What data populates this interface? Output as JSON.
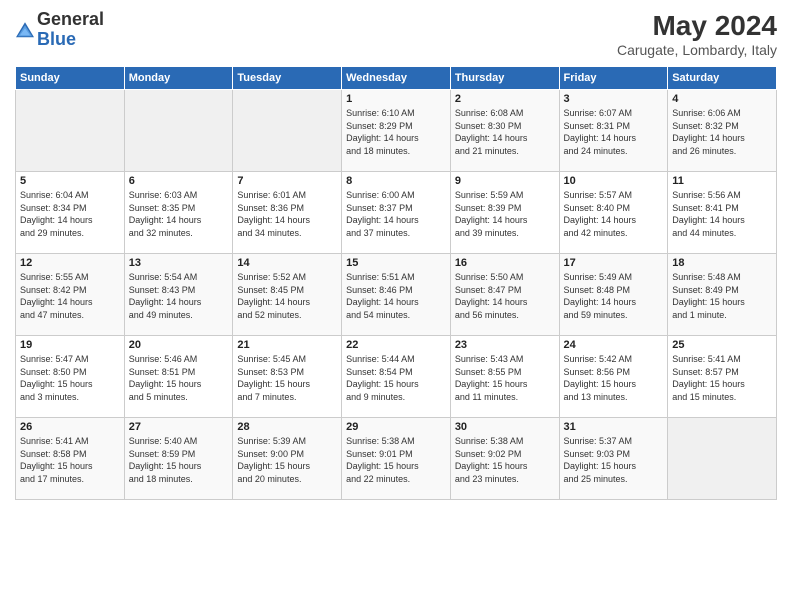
{
  "logo": {
    "line1": "General",
    "line2": "Blue"
  },
  "title": "May 2024",
  "location": "Carugate, Lombardy, Italy",
  "weekdays": [
    "Sunday",
    "Monday",
    "Tuesday",
    "Wednesday",
    "Thursday",
    "Friday",
    "Saturday"
  ],
  "weeks": [
    [
      {
        "day": "",
        "info": ""
      },
      {
        "day": "",
        "info": ""
      },
      {
        "day": "",
        "info": ""
      },
      {
        "day": "1",
        "info": "Sunrise: 6:10 AM\nSunset: 8:29 PM\nDaylight: 14 hours\nand 18 minutes."
      },
      {
        "day": "2",
        "info": "Sunrise: 6:08 AM\nSunset: 8:30 PM\nDaylight: 14 hours\nand 21 minutes."
      },
      {
        "day": "3",
        "info": "Sunrise: 6:07 AM\nSunset: 8:31 PM\nDaylight: 14 hours\nand 24 minutes."
      },
      {
        "day": "4",
        "info": "Sunrise: 6:06 AM\nSunset: 8:32 PM\nDaylight: 14 hours\nand 26 minutes."
      }
    ],
    [
      {
        "day": "5",
        "info": "Sunrise: 6:04 AM\nSunset: 8:34 PM\nDaylight: 14 hours\nand 29 minutes."
      },
      {
        "day": "6",
        "info": "Sunrise: 6:03 AM\nSunset: 8:35 PM\nDaylight: 14 hours\nand 32 minutes."
      },
      {
        "day": "7",
        "info": "Sunrise: 6:01 AM\nSunset: 8:36 PM\nDaylight: 14 hours\nand 34 minutes."
      },
      {
        "day": "8",
        "info": "Sunrise: 6:00 AM\nSunset: 8:37 PM\nDaylight: 14 hours\nand 37 minutes."
      },
      {
        "day": "9",
        "info": "Sunrise: 5:59 AM\nSunset: 8:39 PM\nDaylight: 14 hours\nand 39 minutes."
      },
      {
        "day": "10",
        "info": "Sunrise: 5:57 AM\nSunset: 8:40 PM\nDaylight: 14 hours\nand 42 minutes."
      },
      {
        "day": "11",
        "info": "Sunrise: 5:56 AM\nSunset: 8:41 PM\nDaylight: 14 hours\nand 44 minutes."
      }
    ],
    [
      {
        "day": "12",
        "info": "Sunrise: 5:55 AM\nSunset: 8:42 PM\nDaylight: 14 hours\nand 47 minutes."
      },
      {
        "day": "13",
        "info": "Sunrise: 5:54 AM\nSunset: 8:43 PM\nDaylight: 14 hours\nand 49 minutes."
      },
      {
        "day": "14",
        "info": "Sunrise: 5:52 AM\nSunset: 8:45 PM\nDaylight: 14 hours\nand 52 minutes."
      },
      {
        "day": "15",
        "info": "Sunrise: 5:51 AM\nSunset: 8:46 PM\nDaylight: 14 hours\nand 54 minutes."
      },
      {
        "day": "16",
        "info": "Sunrise: 5:50 AM\nSunset: 8:47 PM\nDaylight: 14 hours\nand 56 minutes."
      },
      {
        "day": "17",
        "info": "Sunrise: 5:49 AM\nSunset: 8:48 PM\nDaylight: 14 hours\nand 59 minutes."
      },
      {
        "day": "18",
        "info": "Sunrise: 5:48 AM\nSunset: 8:49 PM\nDaylight: 15 hours\nand 1 minute."
      }
    ],
    [
      {
        "day": "19",
        "info": "Sunrise: 5:47 AM\nSunset: 8:50 PM\nDaylight: 15 hours\nand 3 minutes."
      },
      {
        "day": "20",
        "info": "Sunrise: 5:46 AM\nSunset: 8:51 PM\nDaylight: 15 hours\nand 5 minutes."
      },
      {
        "day": "21",
        "info": "Sunrise: 5:45 AM\nSunset: 8:53 PM\nDaylight: 15 hours\nand 7 minutes."
      },
      {
        "day": "22",
        "info": "Sunrise: 5:44 AM\nSunset: 8:54 PM\nDaylight: 15 hours\nand 9 minutes."
      },
      {
        "day": "23",
        "info": "Sunrise: 5:43 AM\nSunset: 8:55 PM\nDaylight: 15 hours\nand 11 minutes."
      },
      {
        "day": "24",
        "info": "Sunrise: 5:42 AM\nSunset: 8:56 PM\nDaylight: 15 hours\nand 13 minutes."
      },
      {
        "day": "25",
        "info": "Sunrise: 5:41 AM\nSunset: 8:57 PM\nDaylight: 15 hours\nand 15 minutes."
      }
    ],
    [
      {
        "day": "26",
        "info": "Sunrise: 5:41 AM\nSunset: 8:58 PM\nDaylight: 15 hours\nand 17 minutes."
      },
      {
        "day": "27",
        "info": "Sunrise: 5:40 AM\nSunset: 8:59 PM\nDaylight: 15 hours\nand 18 minutes."
      },
      {
        "day": "28",
        "info": "Sunrise: 5:39 AM\nSunset: 9:00 PM\nDaylight: 15 hours\nand 20 minutes."
      },
      {
        "day": "29",
        "info": "Sunrise: 5:38 AM\nSunset: 9:01 PM\nDaylight: 15 hours\nand 22 minutes."
      },
      {
        "day": "30",
        "info": "Sunrise: 5:38 AM\nSunset: 9:02 PM\nDaylight: 15 hours\nand 23 minutes."
      },
      {
        "day": "31",
        "info": "Sunrise: 5:37 AM\nSunset: 9:03 PM\nDaylight: 15 hours\nand 25 minutes."
      },
      {
        "day": "",
        "info": ""
      }
    ]
  ]
}
